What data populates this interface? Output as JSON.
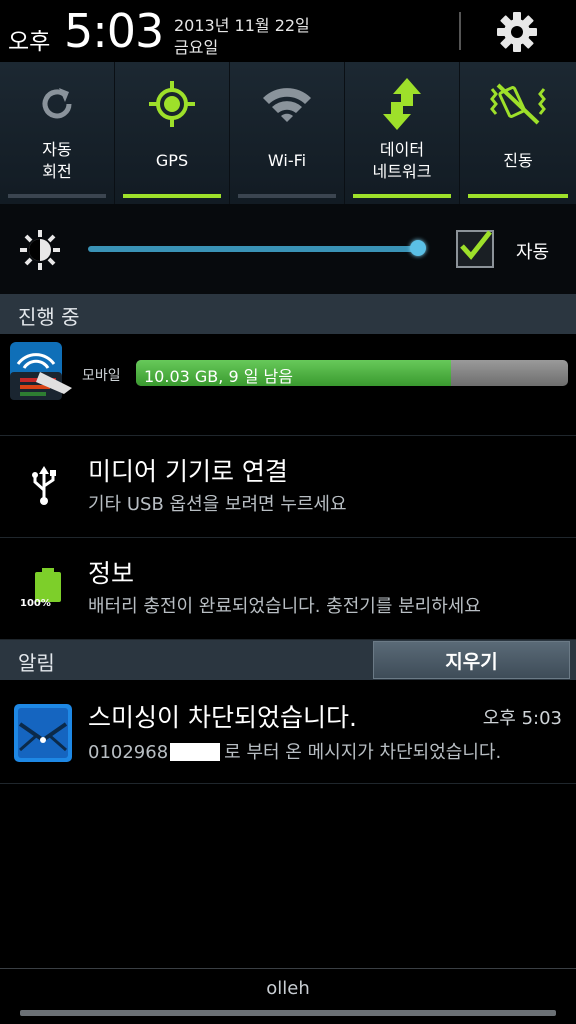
{
  "header": {
    "ampm": "오후",
    "time": "5:03",
    "date": "2013년 11월 22일",
    "weekday": "금요일"
  },
  "toggles": [
    {
      "label": "자동\n회전",
      "icon": "rotate-icon",
      "on": false
    },
    {
      "label": "GPS",
      "icon": "gps-icon",
      "on": true
    },
    {
      "label": "Wi-Fi",
      "icon": "wifi-icon",
      "on": false
    },
    {
      "label": "데이터\n네트워크",
      "icon": "data-network-icon",
      "on": true
    },
    {
      "label": "진동",
      "icon": "vibrate-icon",
      "on": true
    }
  ],
  "brightness": {
    "level": 1.0,
    "auto_label": "자동",
    "auto_checked": true
  },
  "ongoing": {
    "title": "진행 중",
    "data_usage": {
      "label": "모바일",
      "text": "10.03 GB, 9 일 남음",
      "progress": 0.73
    },
    "usb": {
      "title": "미디어 기기로 연결",
      "subtitle": "기타 USB 옵션을 보려면 누르세요"
    },
    "battery": {
      "title": "정보",
      "subtitle": "배터리 충전이 완료되었습니다. 충전기를 분리하세요",
      "level_text": "100%"
    }
  },
  "notifications": {
    "title": "알림",
    "clear_label": "지우기",
    "items": [
      {
        "title": "스미싱이 차단되었습니다.",
        "time": "오후 5:03",
        "number_prefix": "0102968",
        "body_suffix": "로 부터 온 메시지가 차단되었습니다."
      }
    ]
  },
  "carrier": "olleh",
  "colors": {
    "accent_green": "#9ee02a",
    "slider_blue": "#3a93b6",
    "section_bg": "#2b3640",
    "usage_green": "#4caf3f"
  }
}
